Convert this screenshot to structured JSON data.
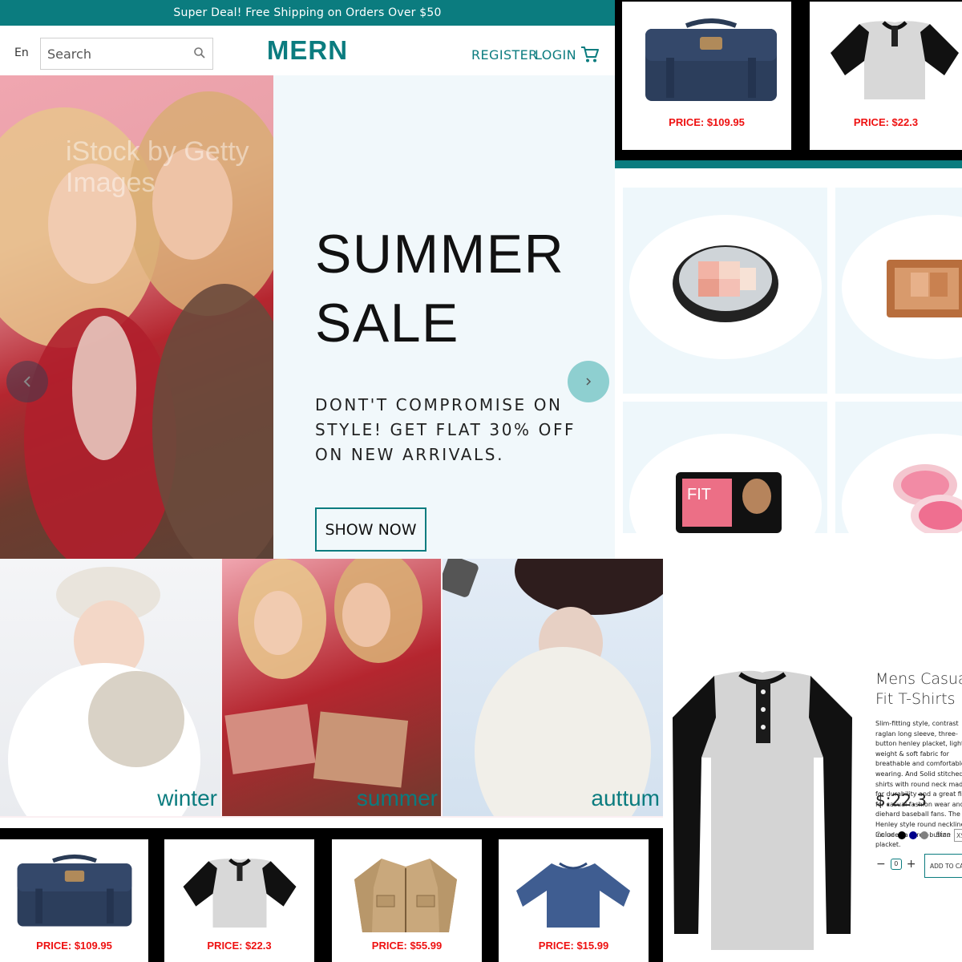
{
  "announcement": "Super Deal! Free Shipping on Orders Over $50",
  "nav": {
    "language": "En",
    "search_placeholder": "Search",
    "logo": "MERN",
    "register": "REGISTER",
    "login": "LOGIN"
  },
  "hero": {
    "title_line1": "SUMMER",
    "title_line2": "SALE",
    "subtitle": "DONT'T COMPROMISE ON STYLE! GET FLAT 30% OFF ON NEW ARRIVALS.",
    "button": "SHOW NOW",
    "watermark": "iStock by Getty Images"
  },
  "top_products": [
    {
      "icon": "bag",
      "price": "PRICE: $109.95"
    },
    {
      "icon": "raglan-shirt",
      "price": "PRICE: $22.3"
    }
  ],
  "cosmetics": [
    {
      "icon": "powder-compact"
    },
    {
      "icon": "bronzer-palette"
    },
    {
      "icon": "fit-me-blush"
    },
    {
      "icon": "pink-blush"
    }
  ],
  "categories": [
    {
      "label": "winter"
    },
    {
      "label": "summer"
    },
    {
      "label": "auttum"
    }
  ],
  "bottom_products": [
    {
      "icon": "bag",
      "price": "PRICE: $109.95"
    },
    {
      "icon": "raglan-shirt",
      "price": "PRICE: $22.3"
    },
    {
      "icon": "jacket",
      "price": "PRICE: $55.99"
    },
    {
      "icon": "long-sleeve-shirt",
      "price": "PRICE: $15.99"
    }
  ],
  "detail": {
    "title": "Mens Casual Fit T-Shirts",
    "description": "Slim-fitting style, contrast raglan long sleeve, three-button henley placket, light weight & soft fabric for breathable and comfortable wearing. And Solid stitched shirts with round neck made for durability and a great fit for casual fashion wear and diehard baseball fans. The Henley style round neckline includes a three-button placket.",
    "price": "$:22.3",
    "color_label": "Color",
    "colors": [
      "#000000",
      "#00008b",
      "#808080"
    ],
    "size_label": "Size",
    "size_value": "XS",
    "quantity": "0",
    "add_to_cart": "ADD TO CART"
  },
  "colors": {
    "brand": "#0b7c7f",
    "price": "#ee1111"
  }
}
